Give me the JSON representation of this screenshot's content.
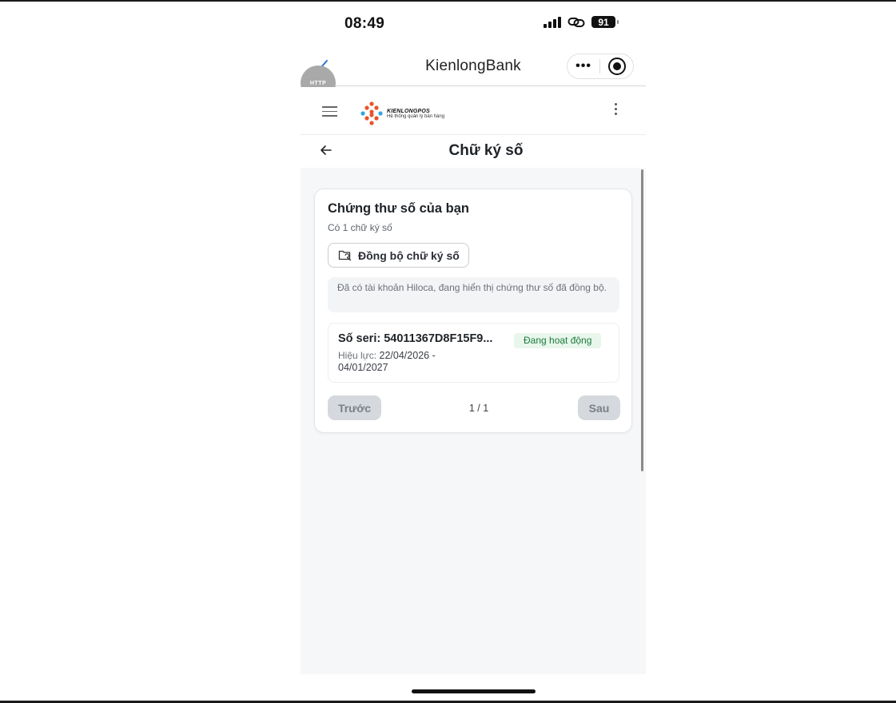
{
  "status_bar": {
    "time": "08:49",
    "battery": "91"
  },
  "mini_app": {
    "title": "KienlongBank",
    "more_label": "•••",
    "http_badge": "HTTP"
  },
  "app_header": {
    "logo_name": "KIENLONGPOS",
    "logo_tagline": "Hệ thống quản lý bán hàng"
  },
  "page": {
    "title": "Chữ ký số"
  },
  "card": {
    "title": "Chứng thư số của bạn",
    "subtitle": "Có 1 chữ ký số",
    "sync_button": "Đồng bộ chữ ký số",
    "info_text": "Đã có tài khoản Hiloca, đang hiển thị chứng thư số đã đồng bộ.",
    "certificates": [
      {
        "serial": "Số seri: 54011367D8F15F9...",
        "validity_label": "Hiệu lực:",
        "validity_value": "22/04/2026 - 04/01/2027",
        "status": "Đang hoạt động"
      }
    ],
    "pagination": {
      "prev_label": "Trước",
      "page_info": "1 / 1",
      "next_label": "Sau"
    }
  },
  "colors": {
    "status_active_bg": "#e8f6ec",
    "status_active_text": "#1b7a3d",
    "logo_orange": "#e8542a",
    "logo_blue": "#2fa6e0",
    "back_arrow_blue": "#2f6fd6"
  }
}
